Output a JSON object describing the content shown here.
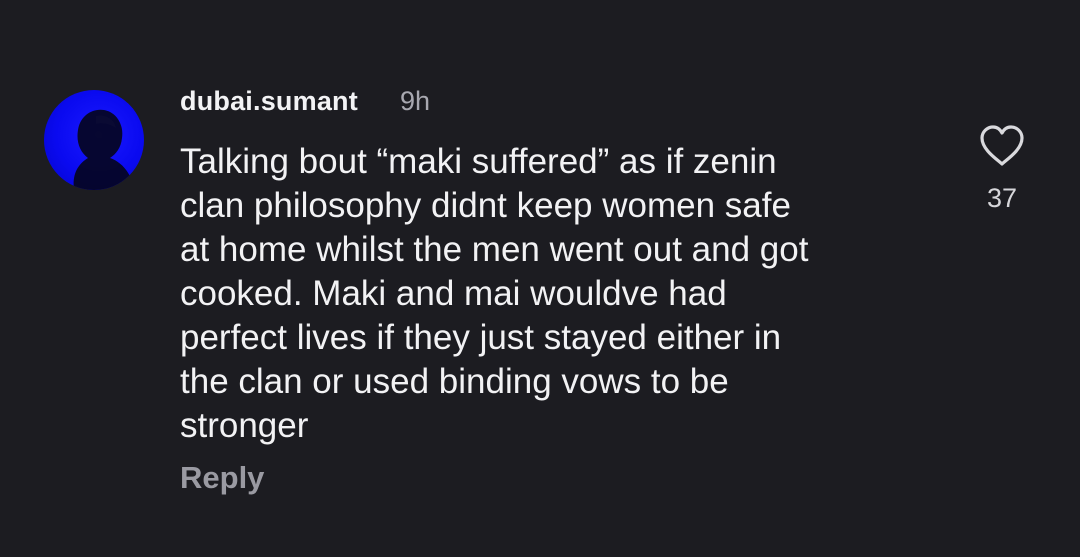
{
  "comment": {
    "username": "dubai.sumant",
    "timestamp": "9h",
    "text_lines": [
      "Talking bout “maki suffered” as if zenin",
      "clan philosophy didnt keep women safe",
      "at home whilst the men went out and got",
      "cooked. Maki and mai wouldve had",
      "perfect lives if they just stayed either in",
      "the clan or used binding vows to be",
      "stronger"
    ],
    "reply_label": "Reply",
    "like_count": "37",
    "like_icon": "heart-outline-icon"
  },
  "colors": {
    "background": "#1c1c21",
    "text": "#f2f2f4",
    "muted": "#a8a8b0",
    "avatar_blue": "#0a0af0"
  }
}
